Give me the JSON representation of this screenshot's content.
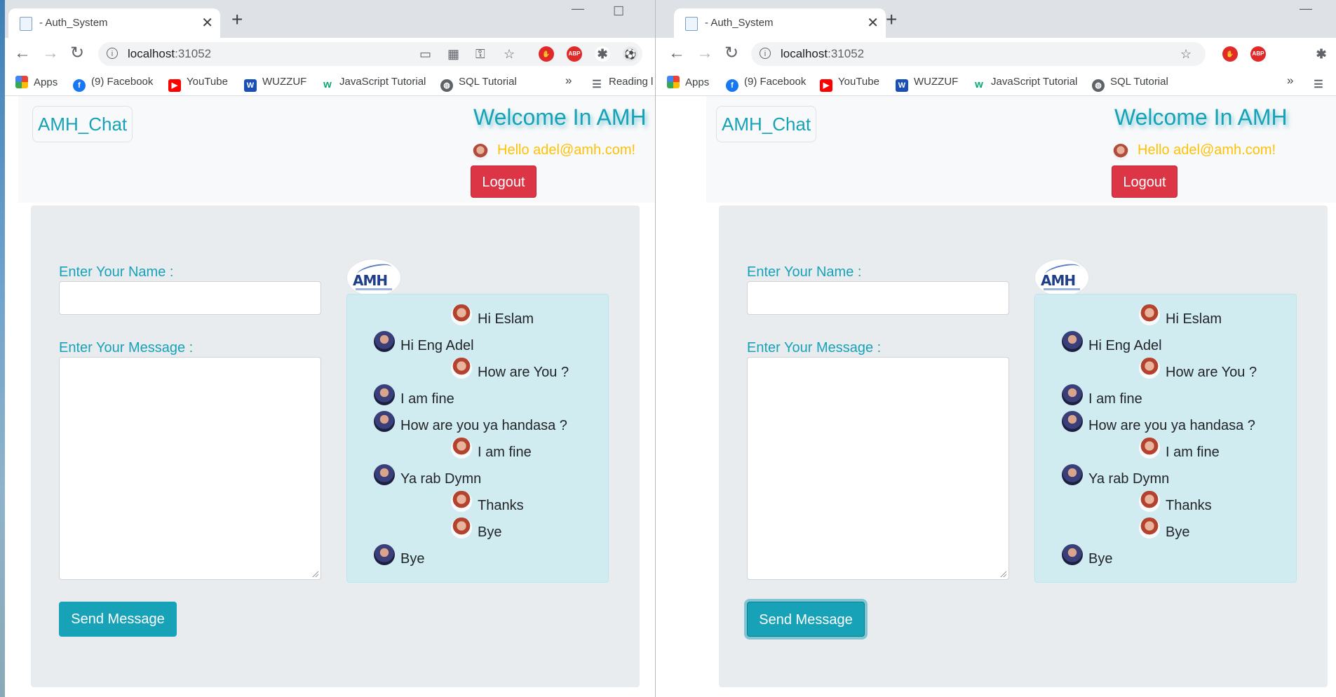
{
  "browser": {
    "tab_title": "- Auth_System",
    "tab_close": "✕",
    "new_tab": "+",
    "url_host": "localhost",
    "url_port": ":31052",
    "bookmarks": {
      "apps": "Apps",
      "facebook": "(9) Facebook",
      "youtube": "YouTube",
      "wuzzuf": "WUZZUF",
      "javascript": "JavaScript Tutorial",
      "sql": "SQL Tutorial",
      "more": "»",
      "reading": "Reading l"
    }
  },
  "app": {
    "brand": "AMH_Chat",
    "welcome": "Welcome In AMH",
    "hello": "Hello adel@amh.com!",
    "logout": "Logout",
    "name_label": "Enter Your Name :",
    "name_value": "",
    "message_label": "Enter Your Message :",
    "message_value": "",
    "send_label": "Send Message",
    "logo_text": "AMH"
  },
  "messages": [
    {
      "sender": "me",
      "text": "Hi Eslam"
    },
    {
      "sender": "other",
      "text": "Hi Eng Adel"
    },
    {
      "sender": "me",
      "text": "How are You ?"
    },
    {
      "sender": "other",
      "text": "I am fine"
    },
    {
      "sender": "other",
      "text": "How are you ya handasa ?"
    },
    {
      "sender": "me",
      "text": "I am fine"
    },
    {
      "sender": "other",
      "text": "Ya rab Dymn"
    },
    {
      "sender": "me",
      "text": "Thanks"
    },
    {
      "sender": "me",
      "text": "Bye"
    },
    {
      "sender": "other",
      "text": "Bye"
    }
  ]
}
